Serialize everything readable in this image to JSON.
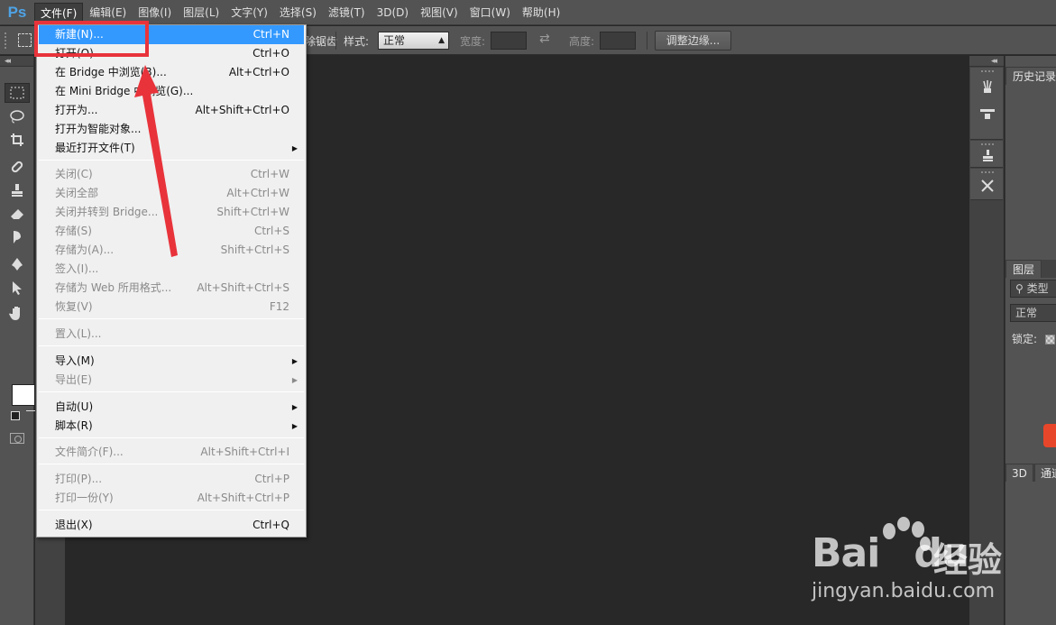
{
  "app": {
    "logo": "Ps"
  },
  "menubar": {
    "items": [
      {
        "label": "文件(F)",
        "active": true
      },
      {
        "label": "编辑(E)"
      },
      {
        "label": "图像(I)"
      },
      {
        "label": "图层(L)"
      },
      {
        "label": "文字(Y)"
      },
      {
        "label": "选择(S)"
      },
      {
        "label": "滤镜(T)"
      },
      {
        "label": "3D(D)"
      },
      {
        "label": "视图(V)"
      },
      {
        "label": "窗口(W)"
      },
      {
        "label": "帮助(H)"
      }
    ]
  },
  "options_bar": {
    "partial_label": "除锯齿",
    "style_label": "样式:",
    "style_value": "正常",
    "width_label": "宽度:",
    "height_label": "高度:",
    "refine_edge_button": "调整边缘..."
  },
  "file_menu": {
    "items": [
      {
        "label": "新建(N)...",
        "shortcut": "Ctrl+N",
        "highlight": true
      },
      {
        "label": "打开(O)...",
        "shortcut": "Ctrl+O"
      },
      {
        "label": "在 Bridge 中浏览(B)...",
        "shortcut": "Alt+Ctrl+O"
      },
      {
        "label": "在 Mini Bridge 中浏览(G)...",
        "shortcut": ""
      },
      {
        "label": "打开为...",
        "shortcut": "Alt+Shift+Ctrl+O"
      },
      {
        "label": "打开为智能对象...",
        "shortcut": ""
      },
      {
        "label": "最近打开文件(T)",
        "shortcut": "",
        "submenu": true
      },
      {
        "label": "关闭(C)",
        "shortcut": "Ctrl+W",
        "disabled": true
      },
      {
        "label": "关闭全部",
        "shortcut": "Alt+Ctrl+W",
        "disabled": true
      },
      {
        "label": "关闭并转到 Bridge...",
        "shortcut": "Shift+Ctrl+W",
        "disabled": true
      },
      {
        "label": "存储(S)",
        "shortcut": "Ctrl+S",
        "disabled": true
      },
      {
        "label": "存储为(A)...",
        "shortcut": "Shift+Ctrl+S",
        "disabled": true
      },
      {
        "label": "签入(I)...",
        "shortcut": "",
        "disabled": true
      },
      {
        "label": "存储为 Web 所用格式...",
        "shortcut": "Alt+Shift+Ctrl+S",
        "disabled": true
      },
      {
        "label": "恢复(V)",
        "shortcut": "F12",
        "disabled": true
      },
      {
        "label": "置入(L)...",
        "shortcut": "",
        "disabled": true
      },
      {
        "label": "导入(M)",
        "shortcut": "",
        "submenu": true
      },
      {
        "label": "导出(E)",
        "shortcut": "",
        "submenu": true,
        "disabled": true
      },
      {
        "label": "自动(U)",
        "shortcut": "",
        "submenu": true
      },
      {
        "label": "脚本(R)",
        "shortcut": "",
        "submenu": true
      },
      {
        "label": "文件简介(F)...",
        "shortcut": "Alt+Shift+Ctrl+I",
        "disabled": true
      },
      {
        "label": "打印(P)...",
        "shortcut": "Ctrl+P",
        "disabled": true
      },
      {
        "label": "打印一份(Y)",
        "shortcut": "Alt+Shift+Ctrl+P",
        "disabled": true
      },
      {
        "label": "退出(X)",
        "shortcut": "Ctrl+Q"
      }
    ]
  },
  "right_panels": {
    "history_tab": "历史记录",
    "layers_tab": "图层",
    "filter_kind": "类型",
    "blend_mode": "正常",
    "lock_label": "锁定:",
    "bottom_tab_3d": "3D",
    "bottom_tab_channels": "通道"
  },
  "watermark": {
    "brand": "Bai",
    "brand_tail": "du",
    "cn": "经验",
    "url": "jingyan.baidu.com"
  },
  "colors": {
    "highlight": "#3399ff",
    "annotation_red": "#e8333b",
    "ps_blue": "#4ea3e6"
  }
}
